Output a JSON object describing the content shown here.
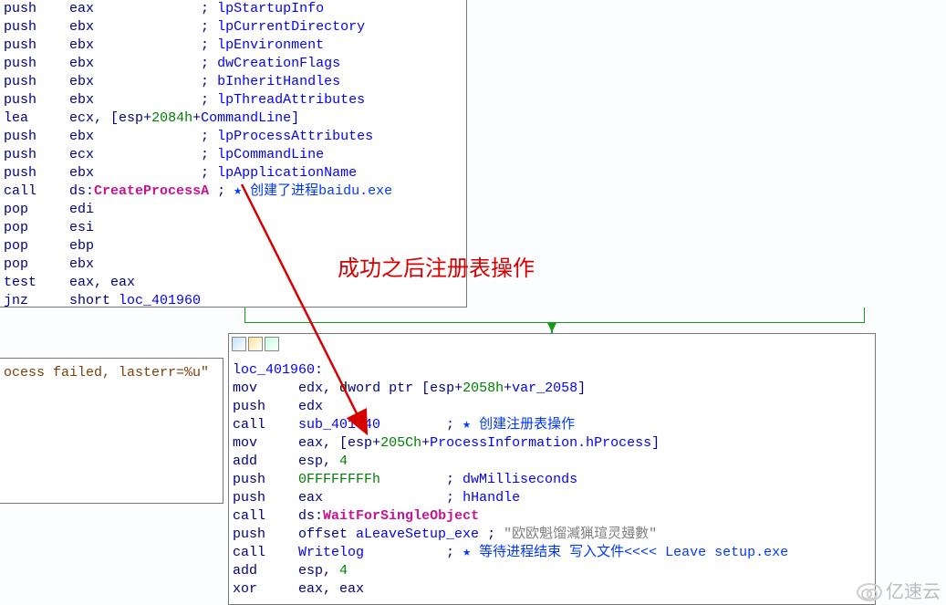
{
  "watermark": "亿速云",
  "annotation": "成功之后注册表操作",
  "box1_lines": [
    [
      [
        "mn",
        "push    "
      ],
      [
        "reg",
        "eax             "
      ],
      [
        "mn",
        "; "
      ],
      [
        "sym",
        "lpStartupInfo"
      ]
    ],
    [
      [
        "mn",
        "push    "
      ],
      [
        "reg",
        "ebx             "
      ],
      [
        "mn",
        "; "
      ],
      [
        "sym",
        "lpCurrentDirectory"
      ]
    ],
    [
      [
        "mn",
        "push    "
      ],
      [
        "reg",
        "ebx             "
      ],
      [
        "mn",
        "; "
      ],
      [
        "sym",
        "lpEnvironment"
      ]
    ],
    [
      [
        "mn",
        "push    "
      ],
      [
        "reg",
        "ebx             "
      ],
      [
        "mn",
        "; "
      ],
      [
        "sym",
        "dwCreationFlags"
      ]
    ],
    [
      [
        "mn",
        "push    "
      ],
      [
        "reg",
        "ebx             "
      ],
      [
        "mn",
        "; "
      ],
      [
        "sym",
        "bInheritHandles"
      ]
    ],
    [
      [
        "mn",
        "push    "
      ],
      [
        "reg",
        "ebx             "
      ],
      [
        "mn",
        "; "
      ],
      [
        "sym",
        "lpThreadAttributes"
      ]
    ],
    [
      [
        "mn",
        "lea     "
      ],
      [
        "reg",
        "ecx"
      ],
      [
        "mn",
        ", ["
      ],
      [
        "reg",
        "esp"
      ],
      [
        "mn",
        "+"
      ],
      [
        "num",
        "2084h"
      ],
      [
        "mn",
        "+"
      ],
      [
        "sym",
        "CommandLine"
      ],
      [
        "mn",
        "]"
      ]
    ],
    [
      [
        "mn",
        "push    "
      ],
      [
        "reg",
        "ebx             "
      ],
      [
        "mn",
        "; "
      ],
      [
        "sym",
        "lpProcessAttributes"
      ]
    ],
    [
      [
        "mn",
        "push    "
      ],
      [
        "reg",
        "ecx             "
      ],
      [
        "mn",
        "; "
      ],
      [
        "sym",
        "lpCommandLine"
      ]
    ],
    [
      [
        "mn",
        "push    "
      ],
      [
        "reg",
        "ebx             "
      ],
      [
        "mn",
        "; "
      ],
      [
        "sym",
        "lpApplicationName"
      ]
    ],
    [
      [
        "mn",
        "call    "
      ],
      [
        "reg",
        "ds"
      ],
      [
        "mn",
        ":"
      ],
      [
        "call",
        "CreateProcessA"
      ],
      [
        "mn",
        " ; "
      ],
      [
        "star",
        "★"
      ],
      [
        "han",
        " 创建了进程baidu.exe"
      ]
    ],
    [
      [
        "mn",
        "pop     "
      ],
      [
        "reg",
        "edi"
      ]
    ],
    [
      [
        "mn",
        "pop     "
      ],
      [
        "reg",
        "esi"
      ]
    ],
    [
      [
        "mn",
        "pop     "
      ],
      [
        "reg",
        "ebp"
      ]
    ],
    [
      [
        "mn",
        "pop     "
      ],
      [
        "reg",
        "ebx"
      ]
    ],
    [
      [
        "mn",
        "test    "
      ],
      [
        "reg",
        "eax"
      ],
      [
        "mn",
        ", "
      ],
      [
        "reg",
        "eax"
      ]
    ],
    [
      [
        "mn",
        "jnz     "
      ],
      [
        "mn",
        "short "
      ],
      [
        "sym",
        "loc_401960"
      ]
    ]
  ],
  "box2_text": "ocess failed, lasterr=%u\"",
  "box3_lines": [
    [
      [
        "sym",
        "loc_401960"
      ],
      [
        "mn",
        ":"
      ]
    ],
    [
      [
        "mn",
        "mov     "
      ],
      [
        "reg",
        "edx"
      ],
      [
        "mn",
        ", "
      ],
      [
        "black",
        "d"
      ],
      [
        "mn",
        "word ptr ["
      ],
      [
        "reg",
        "esp"
      ],
      [
        "mn",
        "+"
      ],
      [
        "num",
        "2058h"
      ],
      [
        "mn",
        "+"
      ],
      [
        "sym",
        "var_2058"
      ],
      [
        "mn",
        "]"
      ]
    ],
    [
      [
        "mn",
        "push    "
      ],
      [
        "reg",
        "edx"
      ]
    ],
    [
      [
        "mn",
        "call    "
      ],
      [
        "sym",
        "sub_401340"
      ],
      [
        "mn",
        "        ; "
      ],
      [
        "star",
        "★"
      ],
      [
        "han",
        " 创建注册表操作"
      ]
    ],
    [
      [
        "mn",
        "mov     "
      ],
      [
        "reg",
        "eax"
      ],
      [
        "mn",
        ", ["
      ],
      [
        "reg",
        "esp"
      ],
      [
        "mn",
        "+"
      ],
      [
        "num",
        "205Ch"
      ],
      [
        "mn",
        "+"
      ],
      [
        "sym",
        "ProcessInformation.hProcess"
      ],
      [
        "mn",
        "]"
      ]
    ],
    [
      [
        "mn",
        "add     "
      ],
      [
        "reg",
        "esp"
      ],
      [
        "mn",
        ", "
      ],
      [
        "num",
        "4"
      ]
    ],
    [
      [
        "mn",
        "push    "
      ],
      [
        "num",
        "0FFFFFFFFh"
      ],
      [
        "mn",
        "        ; "
      ],
      [
        "sym",
        "dwMilliseconds"
      ]
    ],
    [
      [
        "mn",
        "push    "
      ],
      [
        "reg",
        "eax"
      ],
      [
        "mn",
        "               ; "
      ],
      [
        "sym",
        "hHandle"
      ]
    ],
    [
      [
        "mn",
        "call    "
      ],
      [
        "reg",
        "ds"
      ],
      [
        "mn",
        ":"
      ],
      [
        "call",
        "WaitForSingleObject"
      ]
    ],
    [
      [
        "mn",
        "push    "
      ],
      [
        "mn",
        "offset "
      ],
      [
        "sym",
        "aLeaveSetup_exe"
      ],
      [
        "mn",
        " ; "
      ],
      [
        "cmt",
        "\"欧欧魁馏㵴猟瑄灵攳數\""
      ]
    ],
    [
      [
        "mn",
        "call    "
      ],
      [
        "sym",
        "Writelog"
      ],
      [
        "mn",
        "          ; "
      ],
      [
        "star",
        "★"
      ],
      [
        "han",
        " 等待进程结束 写入文件<<<< Leave setup.exe"
      ]
    ],
    [
      [
        "mn",
        "add     "
      ],
      [
        "reg",
        "esp"
      ],
      [
        "mn",
        ", "
      ],
      [
        "num",
        "4"
      ]
    ],
    [
      [
        "mn",
        "xor     "
      ],
      [
        "reg",
        "eax"
      ],
      [
        "mn",
        ", "
      ],
      [
        "reg",
        "eax"
      ]
    ]
  ]
}
